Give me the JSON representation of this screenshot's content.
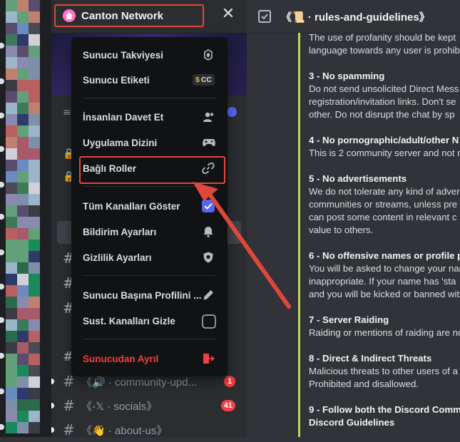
{
  "server": {
    "name": "Canton Network",
    "close_symbol": "✕"
  },
  "chat": {
    "title": "《📜 · rules-and-guidelines》",
    "paragraphs": [
      {
        "heading": "",
        "lines": [
          "The use of profanity should be kept",
          "language towards any user is prohibi"
        ]
      },
      {
        "heading": "3 - No spamming",
        "lines": [
          "Do not send unsolicited Direct Mess",
          "registration/invitation links. Don't se",
          "other. Do not disrupt the chat by sp"
        ]
      },
      {
        "heading": "4 - No pornographic/adult/other N",
        "lines": [
          "This is 2 community server and not r"
        ]
      },
      {
        "heading": "5 - No advertisements",
        "lines": [
          "We do not tolerate any kind of adver",
          "communities or streams, unless pre",
          "can post some content in relevant c",
          "value to others."
        ]
      },
      {
        "heading": "6 - No offensive names or profile p",
        "lines": [
          "You will be asked to change your nar",
          "inappropriate. If your name has 'sta",
          "and you will be kicked or banned wit"
        ]
      },
      {
        "heading": "7 - Server Raiding",
        "lines": [
          "Raiding or mentions of raiding are no"
        ]
      },
      {
        "heading": "8 - Direct & Indirect Threats",
        "lines": [
          "Malicious threats to other users of a",
          "Prohibited and disallowed."
        ]
      },
      {
        "heading": "9 - Follow both the Discord Commu",
        "lines": [
          "Discord Guidelines"
        ]
      }
    ]
  },
  "menu": {
    "items": [
      {
        "label": "Sunucu Takviyesi",
        "icon": "boost-icon"
      },
      {
        "label": "Sunucu Etiketi",
        "icon": "tag-icon",
        "pill": "CC"
      },
      {
        "label": "İnsanları Davet Et",
        "icon": "add-person-icon"
      },
      {
        "label": "Uygulama Dizini",
        "icon": "gamepad-icon"
      },
      {
        "label": "Bağlı Roller",
        "icon": "link-icon"
      },
      {
        "label": "Tüm Kanalları Göster",
        "icon": "checkbox-checked-icon"
      },
      {
        "label": "Bildirim Ayarları",
        "icon": "bell-icon"
      },
      {
        "label": "Gizlilik Ayarları",
        "icon": "shield-icon"
      },
      {
        "label": "Sunucu Başına Profilini ...",
        "icon": "pencil-icon"
      },
      {
        "label": "Sust. Kanalları Gizle",
        "icon": "checkbox-empty-icon"
      },
      {
        "label": "Sunucudan Ayrıl",
        "icon": "leave-icon"
      }
    ]
  },
  "channels": [
    {
      "name": "《🔊 · community-upd...",
      "badge": "1"
    },
    {
      "name": "《-𝕏 · socials》",
      "badge": "41"
    },
    {
      "name": "《👋 · about-us》",
      "badge": ""
    }
  ],
  "colors": {
    "accent_red": "#e0473b",
    "danger": "#f23f43",
    "brand_blurple": "#5865f2",
    "bar_green": "#b8d957"
  }
}
